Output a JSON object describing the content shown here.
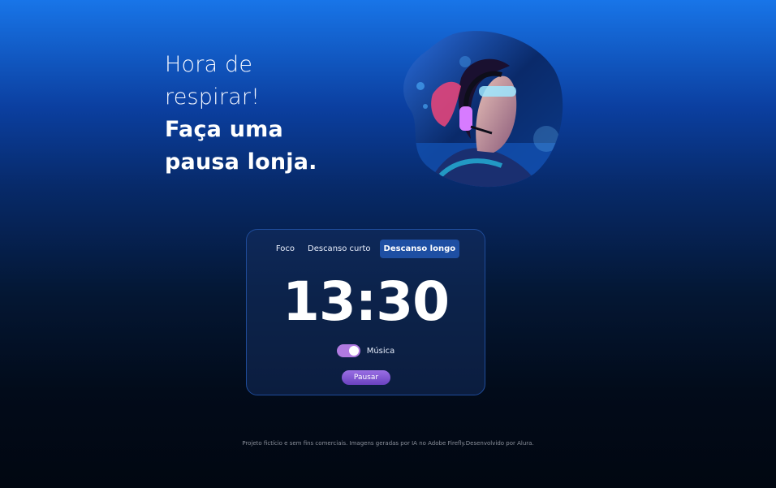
{
  "hero": {
    "line1": "Hora de",
    "line2": "respirar!",
    "line3": "Faça uma",
    "line4": "pausa lonja."
  },
  "image": {
    "description_icon": "woman-headphones-underwater-illustration"
  },
  "timer": {
    "tabs": [
      {
        "label": "Foco",
        "active": false
      },
      {
        "label": "Descanso curto",
        "active": false
      },
      {
        "label": "Descanso longo",
        "active": true
      }
    ],
    "time": "13:30",
    "music_label": "Música",
    "music_on": true,
    "pause_label": "Pausar"
  },
  "footer": {
    "text": "Projeto fictício e sem fins comerciais. Imagens geradas por IA no Adobe Firefly.Desenvolvido por Alura."
  },
  "colors": {
    "accent": "#1e4fa3",
    "toggle": "#b07ae0",
    "button": "#7a52d0"
  }
}
